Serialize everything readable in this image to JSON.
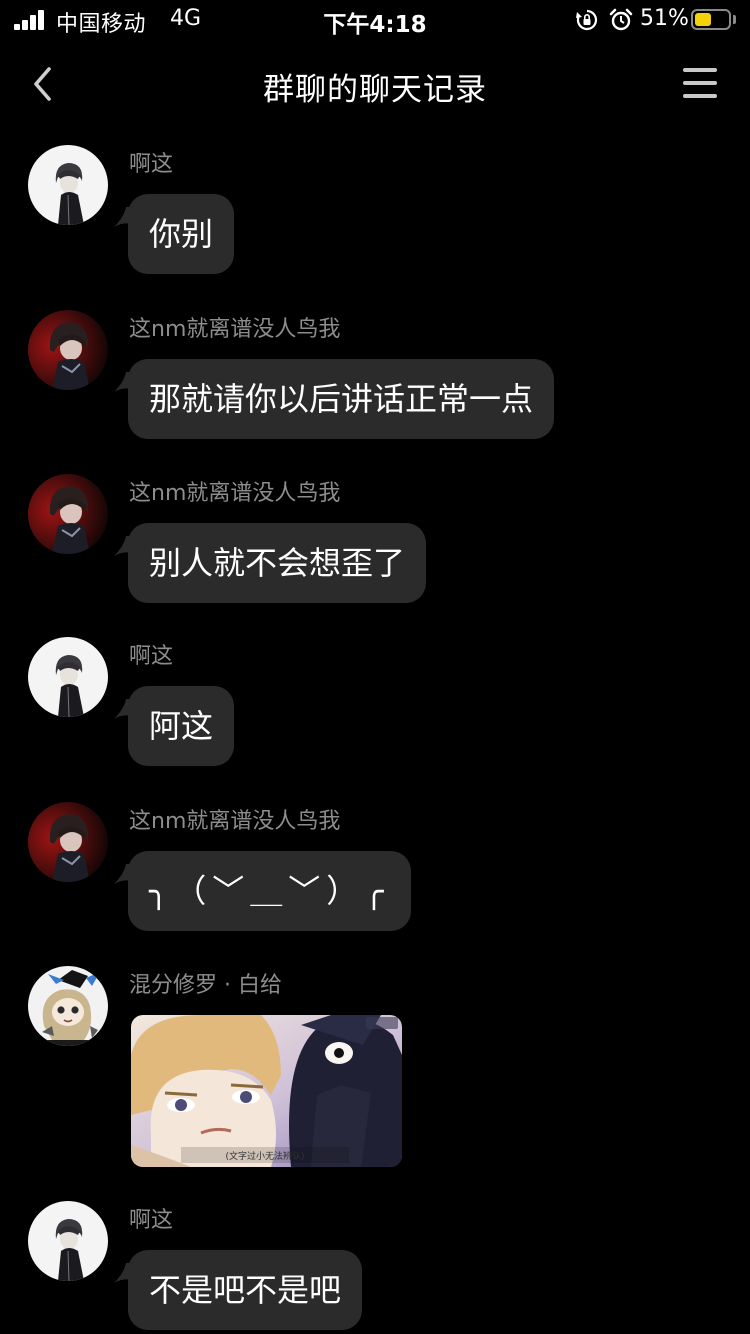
{
  "status_bar": {
    "carrier": "中国移动",
    "network": "4G",
    "time": "下午4:18",
    "battery_percent": "51%",
    "battery_level": 0.51,
    "signal_bars": 4
  },
  "nav": {
    "title": "群聊的聊天记录",
    "back_icon": "chevron-left-icon",
    "menu_icon": "hamburger-menu-icon"
  },
  "colors": {
    "background": "#000000",
    "bubble": "#2b2b2b",
    "sender_name": "#8d8d8d",
    "battery_fill": "#f5d10a"
  },
  "messages": [
    {
      "sender": "啊这",
      "text": "你别",
      "avatar": "avatar-a"
    },
    {
      "sender": "这nm就离谱没人鸟我",
      "text": "那就请你以后讲话正常一点",
      "avatar": "avatar-b"
    },
    {
      "sender": "这nm就离谱没人鸟我",
      "text": "别人就不会想歪了",
      "avatar": "avatar-b"
    },
    {
      "sender": "啊这",
      "text": "阿这",
      "avatar": "avatar-a"
    },
    {
      "sender": "这nm就离谱没人鸟我",
      "text": "╮（﹀＿﹀）╭",
      "avatar": "avatar-b"
    },
    {
      "sender": "混分修罗 · 白给",
      "image_caption": "(文字过小无法辨认)",
      "avatar": "avatar-c"
    },
    {
      "sender": "啊这",
      "text": "不是吧不是吧",
      "avatar": "avatar-a"
    }
  ]
}
